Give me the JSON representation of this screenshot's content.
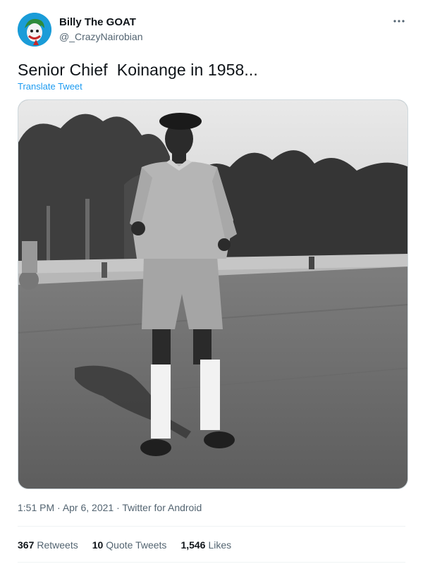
{
  "author": {
    "display_name": "Billy The GOAT",
    "handle": "@_CrazyNairobian",
    "avatar_icon": "joker-avatar-icon"
  },
  "more_icon": "more-options-icon",
  "tweet": {
    "text": "Senior Chief  Koinange in 1958...",
    "translate_label": "Translate Tweet",
    "media_description": "black-and-white photo of a man in uniform standing on a field"
  },
  "meta": {
    "time": "1:51 PM",
    "separator": "·",
    "date": "Apr 6, 2021",
    "source": "Twitter for Android"
  },
  "stats": {
    "retweets_count": "367",
    "retweets_label": "Retweets",
    "quotes_count": "10",
    "quotes_label": "Quote Tweets",
    "likes_count": "1,546",
    "likes_label": "Likes"
  },
  "colors": {
    "link": "#1d9bf0",
    "secondary_text": "#536471",
    "primary_text": "#0f1419"
  }
}
